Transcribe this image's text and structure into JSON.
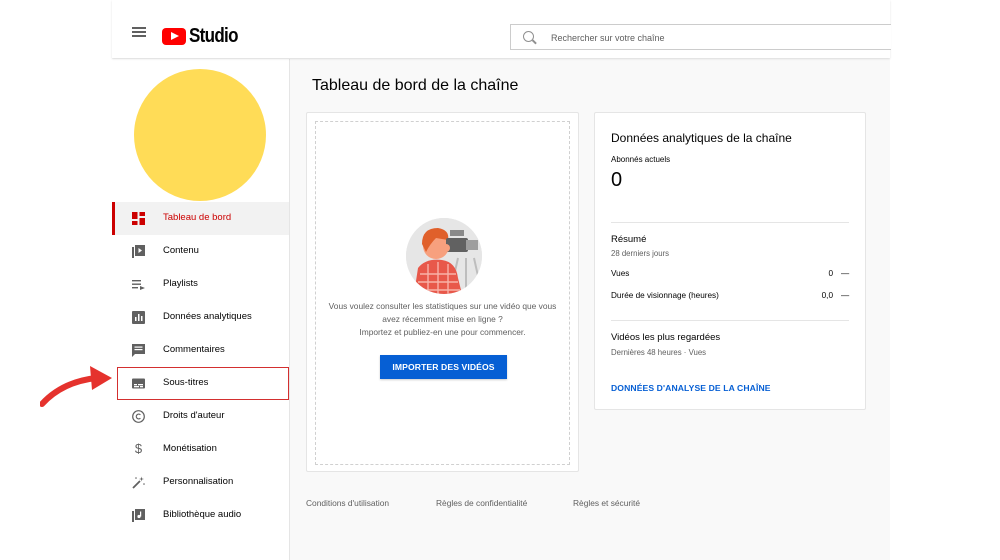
{
  "header": {
    "app_name": "Studio",
    "search_placeholder": "Rechercher sur votre chaîne"
  },
  "sidebar": {
    "items": [
      {
        "label": "Tableau de bord",
        "icon": "dashboard-icon",
        "active": true
      },
      {
        "label": "Contenu",
        "icon": "content-icon"
      },
      {
        "label": "Playlists",
        "icon": "playlists-icon"
      },
      {
        "label": "Données analytiques",
        "icon": "analytics-icon"
      },
      {
        "label": "Commentaires",
        "icon": "comments-icon"
      },
      {
        "label": "Sous-titres",
        "icon": "subtitles-icon",
        "highlighted": true
      },
      {
        "label": "Droits d'auteur",
        "icon": "copyright-icon"
      },
      {
        "label": "Monétisation",
        "icon": "dollar-icon"
      },
      {
        "label": "Personnalisation",
        "icon": "magic-wand-icon"
      },
      {
        "label": "Bibliothèque audio",
        "icon": "audio-library-icon"
      }
    ]
  },
  "main": {
    "title": "Tableau de bord de la chaîne",
    "upload_card": {
      "text_line1": "Vous voulez consulter les statistiques sur une vidéo que vous",
      "text_line2": "avez récemment mise en ligne ?",
      "text_line3": "Importez et publiez-en une pour commencer.",
      "button": "IMPORTER DES VIDÉOS"
    },
    "analytics_card": {
      "title": "Données analytiques de la chaîne",
      "subscribers_label": "Abonnés actuels",
      "subscribers_value": "0",
      "summary_title": "Résumé",
      "summary_period": "28 derniers jours",
      "rows": [
        {
          "label": "Vues",
          "value": "0",
          "trend": "—"
        },
        {
          "label": "Durée de visionnage (heures)",
          "value": "0,0",
          "trend": "—"
        }
      ],
      "top_videos_title": "Vidéos les plus regardées",
      "top_videos_meta": "Dernières 48 heures · Vues",
      "link": "DONNÉES D'ANALYSE DE LA CHAÎNE"
    }
  },
  "footer": {
    "links": [
      "Conditions d'utilisation",
      "Règles de confidentialité",
      "Règles et sécurité"
    ]
  },
  "colors": {
    "accent_red": "#cc0000",
    "brand_red": "#ff0000",
    "button_blue": "#065fd4",
    "avatar_yellow": "#ffdc57",
    "annotation_arrow": "#e5322d"
  }
}
